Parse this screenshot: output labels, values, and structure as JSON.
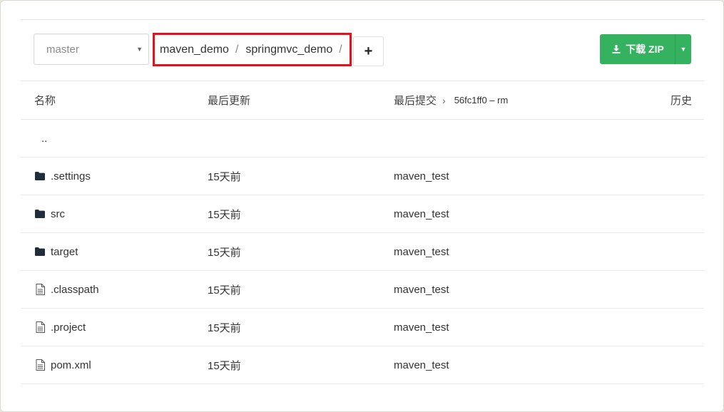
{
  "toolbar": {
    "branch": "master",
    "breadcrumb": [
      {
        "label": "maven_demo"
      },
      {
        "label": "springmvc_demo"
      }
    ],
    "breadcrumb_separator": "/",
    "add_label": "+",
    "download_label": "下载 ZIP"
  },
  "table": {
    "headers": {
      "name": "名称",
      "updated": "最后更新",
      "last_commit": "最后提交",
      "last_commit_hash": "56fc1ff0 – rm",
      "history": "历史"
    },
    "parent": "..",
    "rows": [
      {
        "name": ".settings",
        "type": "folder",
        "updated": "15天前",
        "commit": "maven_test"
      },
      {
        "name": "src",
        "type": "folder",
        "updated": "15天前",
        "commit": "maven_test"
      },
      {
        "name": "target",
        "type": "folder",
        "updated": "15天前",
        "commit": "maven_test"
      },
      {
        "name": ".classpath",
        "type": "file",
        "updated": "15天前",
        "commit": "maven_test"
      },
      {
        "name": ".project",
        "type": "file",
        "updated": "15天前",
        "commit": "maven_test"
      },
      {
        "name": "pom.xml",
        "type": "file",
        "updated": "15天前",
        "commit": "maven_test"
      }
    ]
  },
  "colors": {
    "accent": "#35b260",
    "highlight_border": "#e0131f",
    "icon": "#1f2d3d"
  },
  "icons": {
    "folder": "folder-icon",
    "file": "file-icon",
    "download": "download-icon",
    "caret": "caret-down-icon"
  }
}
